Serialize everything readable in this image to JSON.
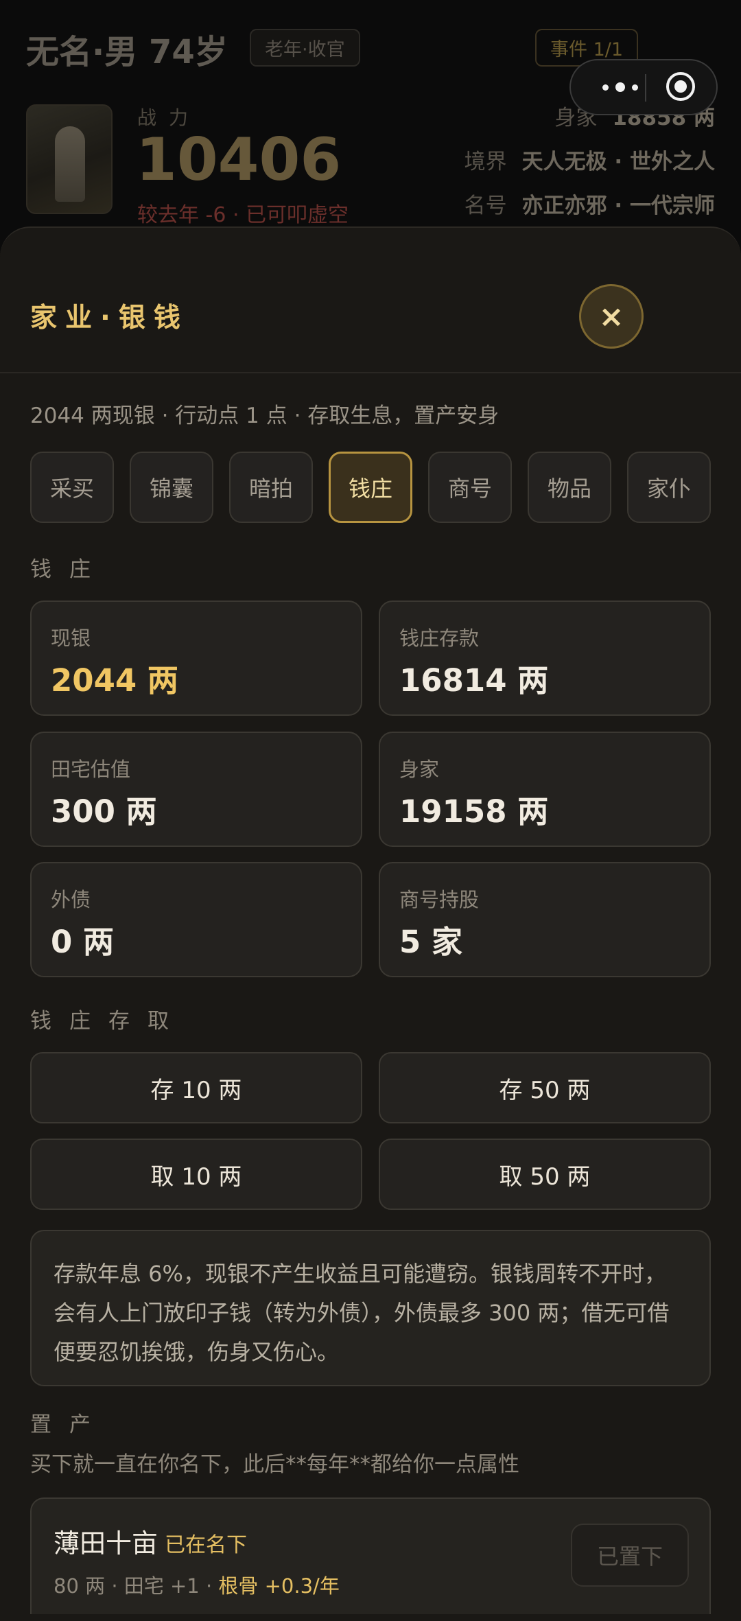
{
  "character": {
    "name": "无名·男 74岁",
    "stage_tag": "老年·收官",
    "event_badge": "事件 1/1",
    "power_label": "战力",
    "power_value": "10406",
    "power_delta": "较去年 -6 · 已可叩虚空",
    "wealth_label": "身家",
    "wealth_value": "18858 两",
    "realm_label": "境界",
    "realm_value": "天人无极 · 世外之人",
    "title_label": "名号",
    "title_value": "亦正亦邪 · 一代宗师"
  },
  "capsule": {
    "more_icon": "more-dots-icon",
    "close_icon": "target-circle-icon"
  },
  "sheet": {
    "title": "家业·银钱",
    "close_label": "×",
    "summary": "2044 两现银 · 行动点 1 点 · 存取生息，置产安身"
  },
  "tabs": [
    {
      "label": "采买",
      "active": false
    },
    {
      "label": "锦囊",
      "active": false
    },
    {
      "label": "暗拍",
      "active": false
    },
    {
      "label": "钱庄",
      "active": true
    },
    {
      "label": "商号",
      "active": false
    },
    {
      "label": "物品",
      "active": false
    },
    {
      "label": "家仆",
      "active": false
    }
  ],
  "bank": {
    "section_title": "钱庄",
    "cards": [
      {
        "label": "现银",
        "value": "2044 两"
      },
      {
        "label": "钱庄存款",
        "value": "16814 两"
      },
      {
        "label": "田宅估值",
        "value": "300 两"
      },
      {
        "label": "身家",
        "value": "19158 两"
      },
      {
        "label": "外债",
        "value": "0 两"
      },
      {
        "label": "商号持股",
        "value": "5 家"
      }
    ]
  },
  "transfer": {
    "section_title": "钱庄存取",
    "buttons": [
      "存 10 两",
      "存 50 两",
      "取 10 两",
      "取 50 两"
    ]
  },
  "note": "存款年息 6%，现银不产生收益且可能遭窃。银钱周转不开时，会有人上门放印子钱（转为外债），外债最多 300 两；借无可借便要忍饥挨饿，伤身又伤心。",
  "property": {
    "section_title": "置产",
    "subtitle": "买下就一直在你名下，此后**每年**都给你一点属性",
    "item": {
      "name": "薄田十亩",
      "status": "已在名下",
      "info": "80 两 · 田宅 +1 · ",
      "bonus": "根骨 +0.3/年",
      "button": "已置下"
    }
  },
  "colors": {
    "accent": "#e9c56e",
    "sheet_bg": "#1a1815",
    "card_bg": "#24221f",
    "danger": "#6b2f2b"
  }
}
